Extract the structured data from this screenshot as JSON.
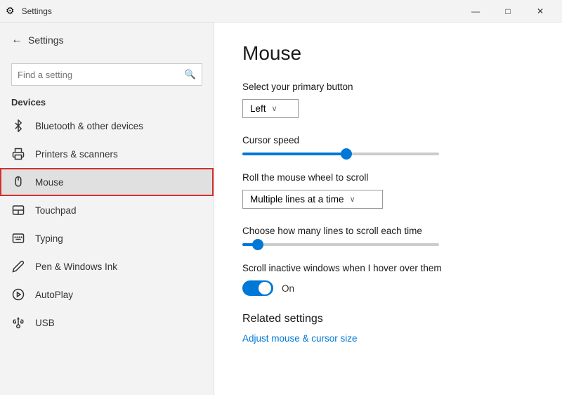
{
  "titlebar": {
    "title": "Settings",
    "minimize": "—",
    "maximize": "□",
    "close": "✕"
  },
  "sidebar": {
    "back_label": "Settings",
    "search_placeholder": "Find a setting",
    "section_label": "Devices",
    "nav_items": [
      {
        "id": "bluetooth",
        "label": "Bluetooth & other devices",
        "icon": "bluetooth"
      },
      {
        "id": "printers",
        "label": "Printers & scanners",
        "icon": "printer"
      },
      {
        "id": "mouse",
        "label": "Mouse",
        "icon": "mouse",
        "active": true
      },
      {
        "id": "touchpad",
        "label": "Touchpad",
        "icon": "touchpad"
      },
      {
        "id": "typing",
        "label": "Typing",
        "icon": "typing"
      },
      {
        "id": "pen",
        "label": "Pen & Windows Ink",
        "icon": "pen"
      },
      {
        "id": "autoplay",
        "label": "AutoPlay",
        "icon": "autoplay"
      },
      {
        "id": "usb",
        "label": "USB",
        "icon": "usb"
      }
    ]
  },
  "content": {
    "page_title": "Mouse",
    "primary_button": {
      "label": "Select your primary button",
      "value": "Left",
      "chevron": "∨"
    },
    "cursor_speed": {
      "label": "Cursor speed",
      "percent": 53
    },
    "scroll_dropdown": {
      "label": "Roll the mouse wheel to scroll",
      "value": "Multiple lines at a time",
      "chevron": "∨"
    },
    "scroll_lines": {
      "label": "Choose how many lines to scroll each time",
      "percent": 8
    },
    "scroll_inactive": {
      "label": "Scroll inactive windows when I hover over them",
      "state": "On"
    },
    "related_settings": {
      "title": "Related settings",
      "link": "Adjust mouse & cursor size"
    }
  }
}
